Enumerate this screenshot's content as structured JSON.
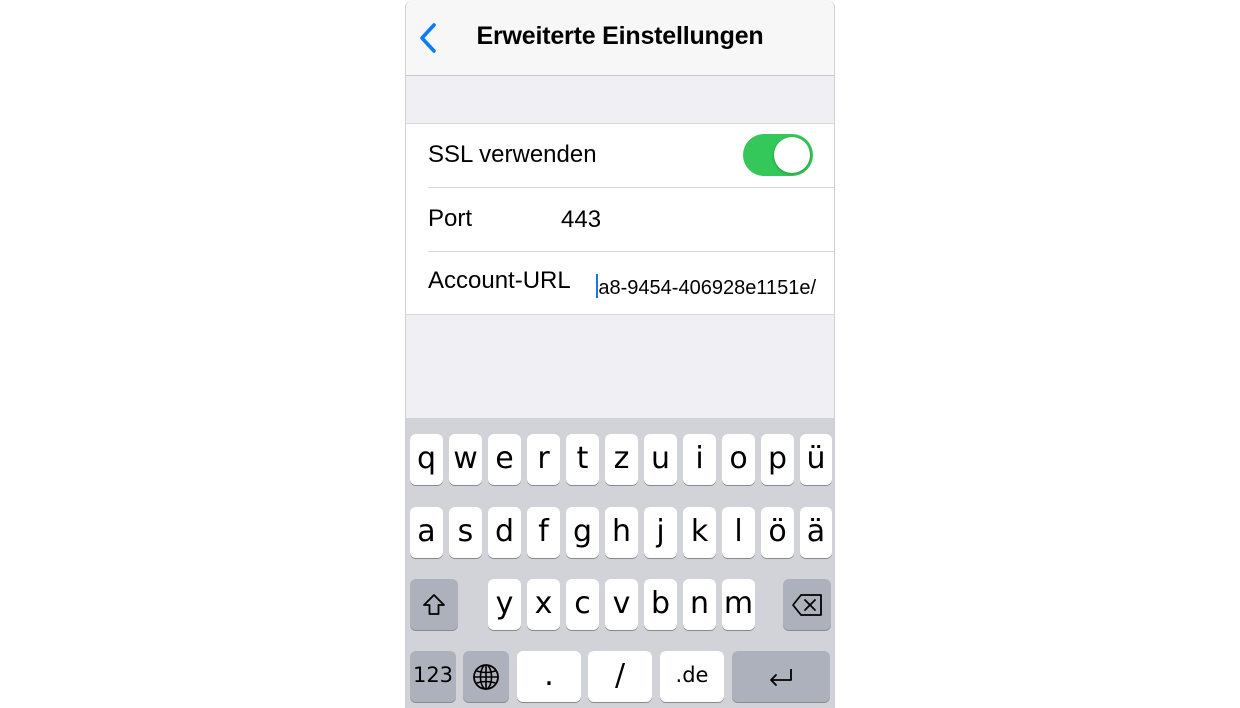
{
  "navbar": {
    "title": "Erweiterte Einstellungen",
    "back_icon": "chevron-left-icon",
    "accent_color": "#0a7aff"
  },
  "settings": {
    "ssl": {
      "label": "SSL verwenden",
      "enabled": true,
      "toggle_color": "#34c759"
    },
    "port": {
      "label": "Port",
      "value": "443"
    },
    "account_url": {
      "label": "Account-URL",
      "value": "a8-9454-406928e1151e/"
    }
  },
  "keyboard": {
    "row1": [
      "q",
      "w",
      "e",
      "r",
      "t",
      "z",
      "u",
      "i",
      "o",
      "p",
      "ü"
    ],
    "row2": [
      "a",
      "s",
      "d",
      "f",
      "g",
      "h",
      "j",
      "k",
      "l",
      "ö",
      "ä"
    ],
    "row3": [
      "y",
      "x",
      "c",
      "v",
      "b",
      "n",
      "m"
    ],
    "numbers_label": "123",
    "dot_label": ".",
    "slash_label": "/",
    "domain_label": ".de",
    "shift_icon": "shift-icon",
    "delete_icon": "backspace-icon",
    "globe_icon": "globe-icon",
    "return_icon": "return-icon"
  }
}
